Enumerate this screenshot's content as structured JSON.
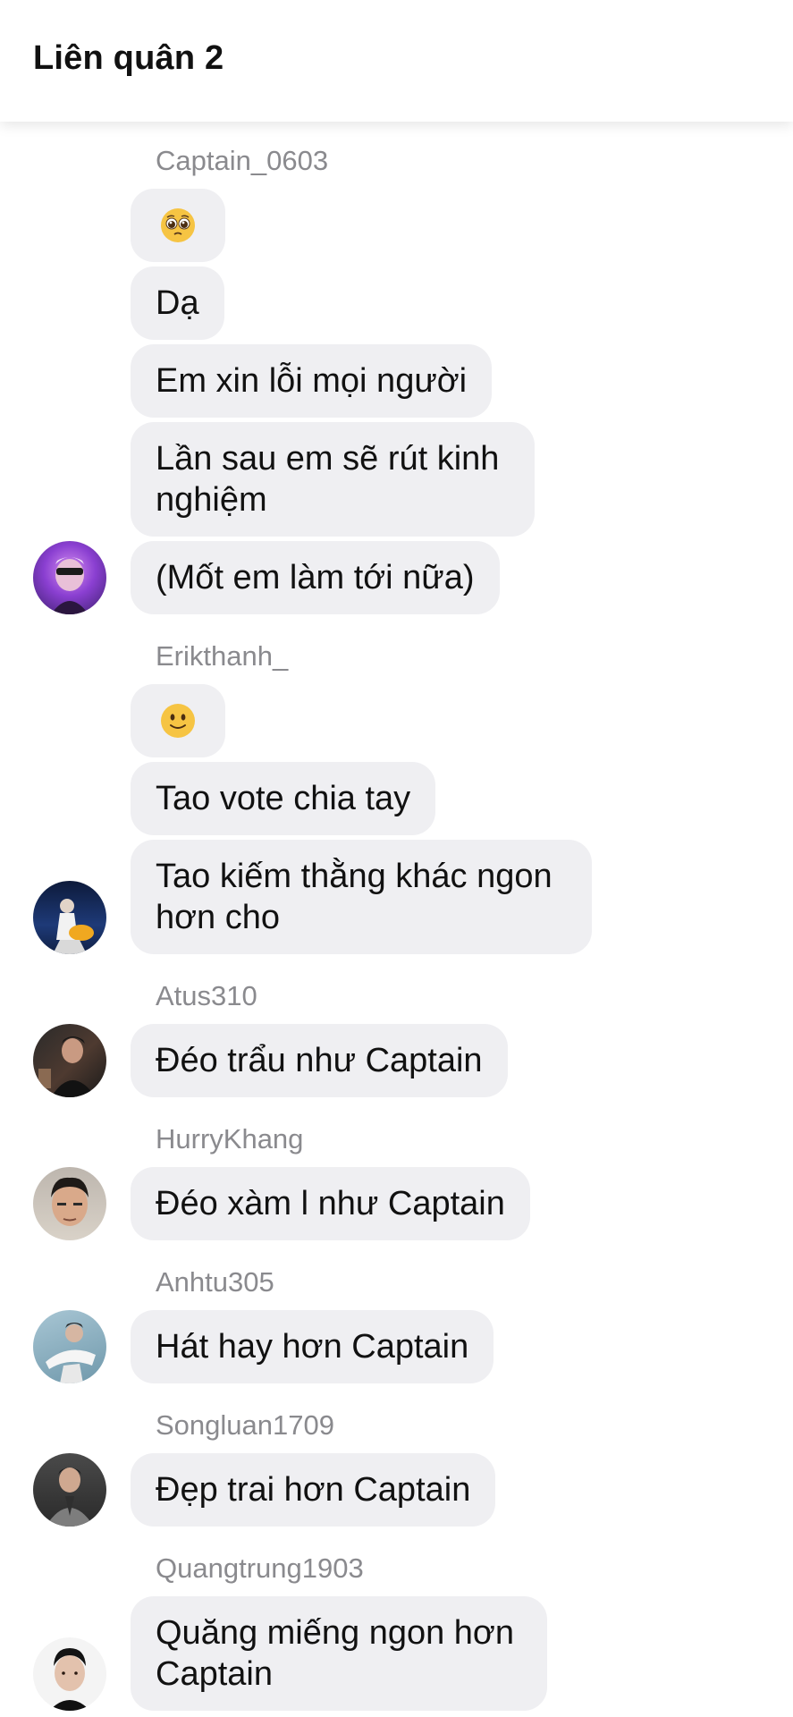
{
  "header": {
    "title": "Liên quân 2"
  },
  "groups": [
    {
      "sender": "Captain_0603",
      "avatar": "avatar-purple-sunglasses",
      "messages": [
        {
          "icon": "pleading-face-emoji"
        },
        {
          "text": "Dạ"
        },
        {
          "text": "Em xin lỗi mọi người"
        },
        {
          "text": "Lần sau em sẽ rút kinh nghiệm"
        },
        {
          "text": "(Mốt em làm tới nữa)"
        }
      ]
    },
    {
      "sender": "Erikthanh_",
      "avatar": "avatar-stage-performer",
      "messages": [
        {
          "icon": "slightly-smiling-face-emoji"
        },
        {
          "text": "Tao vote chia tay"
        },
        {
          "text": "Tao kiếm thằng khác ngon hơn cho"
        }
      ]
    },
    {
      "sender": "Atus310",
      "avatar": "avatar-dark-portrait",
      "messages": [
        {
          "text": "Đéo trẩu như Captain"
        }
      ]
    },
    {
      "sender": "HurryKhang",
      "avatar": "avatar-selfie",
      "messages": [
        {
          "text": "Đéo xàm l như Captain"
        }
      ]
    },
    {
      "sender": "Anhtu305",
      "avatar": "avatar-blue-white",
      "messages": [
        {
          "text": "Hát hay hơn Captain"
        }
      ]
    },
    {
      "sender": "Songluan1709",
      "avatar": "avatar-grey-suit",
      "messages": [
        {
          "text": "Đẹp trai hơn Captain"
        }
      ]
    },
    {
      "sender": "Quangtrung1903",
      "avatar": "avatar-white-background",
      "messages": [
        {
          "text": "Quăng miếng ngon hơn Captain"
        }
      ]
    }
  ],
  "colors": {
    "bubble": "#efeff2",
    "sender": "#8a8a8e",
    "text": "#111111",
    "emoji": "#f6c443"
  }
}
